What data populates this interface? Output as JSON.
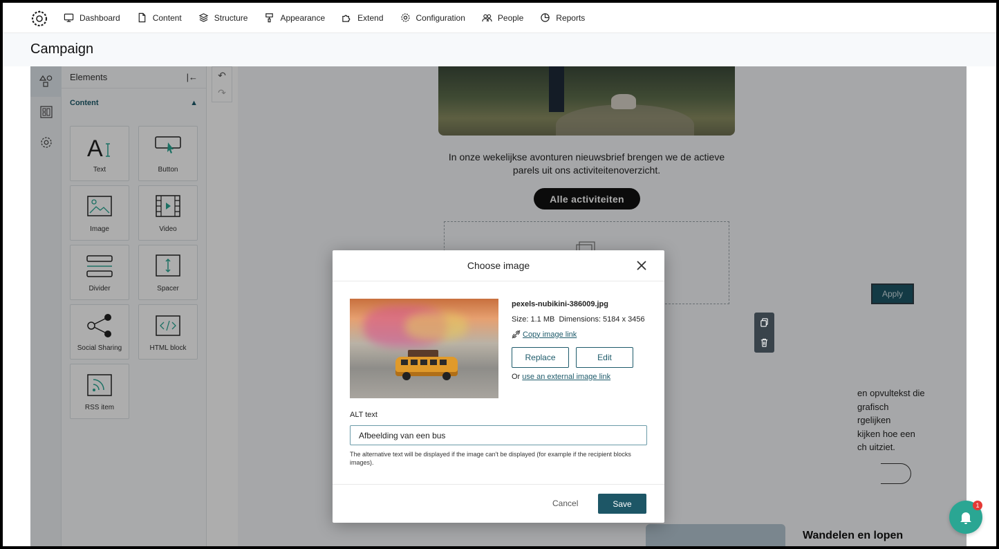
{
  "nav": {
    "items": [
      {
        "label": "Dashboard",
        "icon": "monitor-icon"
      },
      {
        "label": "Content",
        "icon": "document-icon"
      },
      {
        "label": "Structure",
        "icon": "layers-icon"
      },
      {
        "label": "Appearance",
        "icon": "paint-icon"
      },
      {
        "label": "Extend",
        "icon": "puzzle-icon"
      },
      {
        "label": "Configuration",
        "icon": "gear-icon"
      },
      {
        "label": "People",
        "icon": "people-icon"
      },
      {
        "label": "Reports",
        "icon": "pie-chart-icon"
      }
    ]
  },
  "page": {
    "title": "Campaign"
  },
  "elements_panel": {
    "title": "Elements",
    "section": "Content",
    "tiles": [
      {
        "label": "Text",
        "icon": "text-icon"
      },
      {
        "label": "Button",
        "icon": "button-icon"
      },
      {
        "label": "Image",
        "icon": "image-icon"
      },
      {
        "label": "Video",
        "icon": "video-icon"
      },
      {
        "label": "Divider",
        "icon": "divider-icon"
      },
      {
        "label": "Spacer",
        "icon": "spacer-icon"
      },
      {
        "label": "Social Sharing",
        "icon": "share-icon"
      },
      {
        "label": "HTML block",
        "icon": "code-icon"
      },
      {
        "label": "RSS item",
        "icon": "rss-icon"
      }
    ]
  },
  "canvas": {
    "intro": "In onze wekelijkse avonturen nieuwsbrief brengen we de actieve parels uit ons activiteitenoverzicht.",
    "cta_label": "Alle activiteiten",
    "apply_label": "Apply",
    "body_lines": [
      "en opvultekst die",
      "grafisch",
      "rgelijken",
      "kijken hoe een",
      "ch uitziet."
    ],
    "heading2": "Wandelen en lopen"
  },
  "modal": {
    "title": "Choose image",
    "file_name": "pexels-nubikini-386009.jpg",
    "size_label": "Size: 1.1 MB",
    "dimensions_label": "Dimensions: 5184 x 3456",
    "copy_link": "Copy image link",
    "replace_label": "Replace",
    "edit_label": "Edit",
    "or_text": "Or",
    "external_link": "use an external image link",
    "alt_label": "ALT text",
    "alt_value": "Afbeelding van een bus",
    "alt_help": "The alternative text will be displayed if the image can't be displayed (for example if the recipient blocks images).",
    "cancel_label": "Cancel",
    "save_label": "Save"
  },
  "notifications": {
    "count": "1"
  },
  "colors": {
    "accent": "#1d5666",
    "bell": "#2aa693",
    "badge": "#e53935"
  }
}
